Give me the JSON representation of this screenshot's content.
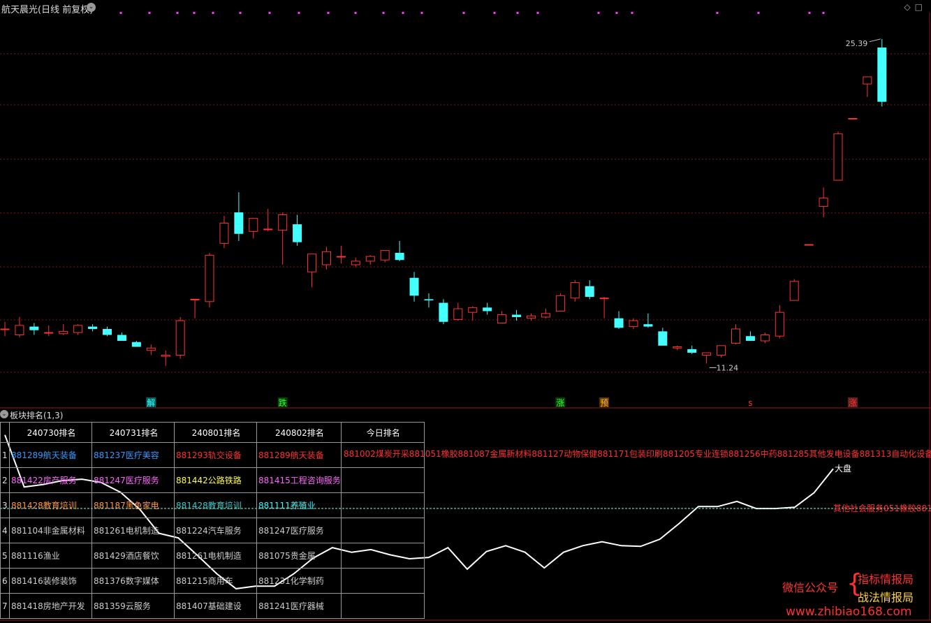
{
  "header": {
    "title": "航天晨光(日线 前复权)",
    "high_label": "25.39",
    "low_label": "11.24"
  },
  "sub_panel": {
    "title": "板块排名(1,3)",
    "index_label": "大盘"
  },
  "table": {
    "headers": [
      "",
      "240730排名",
      "240731排名",
      "240801排名",
      "240802排名",
      "今日排名"
    ],
    "rows": [
      {
        "no": "1",
        "cells": [
          {
            "t": "881289航天装备",
            "c": "#3399ff"
          },
          {
            "t": "881237医疗美容",
            "c": "#3399ff"
          },
          {
            "t": "881293轨交设备",
            "c": "#ff3030"
          },
          {
            "t": "881289航天装备",
            "c": "#ff3030"
          },
          {
            "t": "",
            "c": "#ff3030"
          }
        ]
      },
      {
        "no": "2",
        "cells": [
          {
            "t": "881422房产服务",
            "c": "#ff66ff"
          },
          {
            "t": "881247医疗服务",
            "c": "#ff66ff"
          },
          {
            "t": "881442公路铁路",
            "c": "#ffff44"
          },
          {
            "t": "881415工程咨询服务",
            "c": "#ff66ff"
          },
          {
            "t": "",
            "c": "#ff66ff"
          }
        ]
      },
      {
        "no": "3",
        "cells": [
          {
            "t": "881428教育培训",
            "c": "#ff9933"
          },
          {
            "t": "881187黑色家电",
            "c": "#ff9933"
          },
          {
            "t": "881428教育培训",
            "c": "#33cccc"
          },
          {
            "t": "881111养殖业",
            "c": "#33ffff"
          },
          {
            "t": "",
            "c": "#ff9933"
          }
        ]
      },
      {
        "no": "4",
        "cells": [
          {
            "t": "881104非金属材料",
            "c": "#ccc"
          },
          {
            "t": "881261电机制造",
            "c": "#ccc"
          },
          {
            "t": "881224汽车服务",
            "c": "#ccc"
          },
          {
            "t": "881247医疗服务",
            "c": "#ccc"
          },
          {
            "t": "",
            "c": "#ccc"
          }
        ]
      },
      {
        "no": "5",
        "cells": [
          {
            "t": "881116渔业",
            "c": "#ccc"
          },
          {
            "t": "881429酒店餐饮",
            "c": "#ccc"
          },
          {
            "t": "881261电机制造",
            "c": "#ccc"
          },
          {
            "t": "881075贵金属",
            "c": "#ccc"
          },
          {
            "t": "",
            "c": "#ccc"
          }
        ]
      },
      {
        "no": "6",
        "cells": [
          {
            "t": "881416装修装饰",
            "c": "#ccc"
          },
          {
            "t": "881376数字媒体",
            "c": "#ccc"
          },
          {
            "t": "881215商用车",
            "c": "#ccc"
          },
          {
            "t": "881231化学制药",
            "c": "#ccc"
          },
          {
            "t": "",
            "c": "#ccc"
          }
        ]
      },
      {
        "no": "7",
        "cells": [
          {
            "t": "881418房地产开发",
            "c": "#ccc"
          },
          {
            "t": "881359云服务",
            "c": "#ccc"
          },
          {
            "t": "881407基础建设",
            "c": "#ccc"
          },
          {
            "t": "881241医疗器械",
            "c": "#ccc"
          },
          {
            "t": "",
            "c": "#ccc"
          }
        ]
      }
    ],
    "today_rank_1": "881002煤炭开采881051橡胶881087金属新材料881127动物保健881171包装印刷881205专业连锁881256中药881285其他发电设备881313自动化设备881317"
  },
  "overlay_text": "其他社会服务051橡胶881",
  "watermark": {
    "line1": "微信公众号",
    "line2": "指标情报局",
    "line3": "战法情报局",
    "url": "www.zhibiao168.com"
  },
  "chart_data": [
    {
      "type": "candlestick",
      "title": "航天晨光(日线 前复权)",
      "y_axis_hidden": true,
      "ylim": [
        10.0,
        26.5
      ],
      "candles": [
        {
          "o": 13.2,
          "h": 13.5,
          "l": 12.9,
          "c": 13.2
        },
        {
          "o": 12.95,
          "h": 13.7,
          "l": 12.85,
          "c": 13.35
        },
        {
          "o": 13.3,
          "h": 13.45,
          "l": 12.95,
          "c": 13.15
        },
        {
          "o": 13.05,
          "h": 13.35,
          "l": 12.9,
          "c": 13.05
        },
        {
          "o": 13.0,
          "h": 13.4,
          "l": 12.95,
          "c": 13.1
        },
        {
          "o": 13.05,
          "h": 13.4,
          "l": 12.95,
          "c": 13.35
        },
        {
          "o": 13.3,
          "h": 13.4,
          "l": 13.1,
          "c": 13.2
        },
        {
          "o": 13.2,
          "h": 13.3,
          "l": 12.9,
          "c": 12.95
        },
        {
          "o": 12.95,
          "h": 13.05,
          "l": 12.7,
          "c": 12.7
        },
        {
          "o": 12.65,
          "h": 12.7,
          "l": 12.5,
          "c": 12.45
        },
        {
          "o": 12.3,
          "h": 12.55,
          "l": 12.1,
          "c": 12.4
        },
        {
          "o": 12.05,
          "h": 12.3,
          "l": 11.65,
          "c": 12.1
        },
        {
          "o": 12.1,
          "h": 13.7,
          "l": 11.95,
          "c": 13.55
        },
        {
          "o": 14.45,
          "h": 14.45,
          "l": 13.65,
          "c": 14.45
        },
        {
          "o": 14.35,
          "h": 16.4,
          "l": 14.1,
          "c": 16.3
        },
        {
          "o": 16.8,
          "h": 17.95,
          "l": 16.6,
          "c": 17.65
        },
        {
          "o": 18.1,
          "h": 18.95,
          "l": 16.9,
          "c": 17.2
        },
        {
          "o": 17.3,
          "h": 17.8,
          "l": 17.0,
          "c": 17.85
        },
        {
          "o": 17.4,
          "h": 18.25,
          "l": 17.3,
          "c": 17.4
        },
        {
          "o": 17.35,
          "h": 18.1,
          "l": 15.9,
          "c": 18.0
        },
        {
          "o": 17.6,
          "h": 18.0,
          "l": 16.7,
          "c": 16.85
        },
        {
          "o": 15.6,
          "h": 16.35,
          "l": 14.95,
          "c": 16.35
        },
        {
          "o": 15.9,
          "h": 16.65,
          "l": 15.7,
          "c": 16.45
        },
        {
          "o": 16.25,
          "h": 16.7,
          "l": 15.95,
          "c": 16.25
        },
        {
          "o": 15.9,
          "h": 16.2,
          "l": 15.8,
          "c": 16.05
        },
        {
          "o": 16.05,
          "h": 16.3,
          "l": 15.9,
          "c": 16.25
        },
        {
          "o": 16.1,
          "h": 16.5,
          "l": 16.0,
          "c": 16.5
        },
        {
          "o": 16.4,
          "h": 16.9,
          "l": 16.05,
          "c": 16.1
        },
        {
          "o": 15.35,
          "h": 15.6,
          "l": 14.35,
          "c": 14.6
        },
        {
          "o": 14.45,
          "h": 14.7,
          "l": 14.1,
          "c": 14.4
        },
        {
          "o": 14.3,
          "h": 14.45,
          "l": 13.4,
          "c": 13.5
        },
        {
          "o": 13.6,
          "h": 14.3,
          "l": 13.55,
          "c": 14.05
        },
        {
          "o": 13.9,
          "h": 14.15,
          "l": 13.55,
          "c": 14.1
        },
        {
          "o": 14.1,
          "h": 14.3,
          "l": 13.8,
          "c": 13.95
        },
        {
          "o": 13.45,
          "h": 13.95,
          "l": 13.45,
          "c": 13.8
        },
        {
          "o": 13.8,
          "h": 14.0,
          "l": 13.55,
          "c": 13.7
        },
        {
          "o": 13.65,
          "h": 13.85,
          "l": 13.55,
          "c": 13.75
        },
        {
          "o": 13.7,
          "h": 14.05,
          "l": 13.65,
          "c": 13.85
        },
        {
          "o": 13.95,
          "h": 14.7,
          "l": 13.95,
          "c": 14.6
        },
        {
          "o": 14.5,
          "h": 15.25,
          "l": 14.35,
          "c": 15.15
        },
        {
          "o": 15.0,
          "h": 15.25,
          "l": 14.45,
          "c": 14.55
        },
        {
          "o": 14.5,
          "h": 14.55,
          "l": 13.65,
          "c": 14.5
        },
        {
          "o": 13.65,
          "h": 13.95,
          "l": 13.2,
          "c": 13.25
        },
        {
          "o": 13.3,
          "h": 13.65,
          "l": 13.2,
          "c": 13.55
        },
        {
          "o": 13.4,
          "h": 13.85,
          "l": 13.25,
          "c": 13.3
        },
        {
          "o": 13.1,
          "h": 13.25,
          "l": 12.5,
          "c": 12.5
        },
        {
          "o": 12.4,
          "h": 12.5,
          "l": 12.3,
          "c": 12.45
        },
        {
          "o": 12.35,
          "h": 12.5,
          "l": 12.15,
          "c": 12.2
        },
        {
          "o": 12.1,
          "h": 12.2,
          "l": 11.75,
          "c": 12.2
        },
        {
          "o": 12.1,
          "h": 12.5,
          "l": 12.0,
          "c": 12.5
        },
        {
          "o": 12.6,
          "h": 13.4,
          "l": 12.55,
          "c": 13.2
        },
        {
          "o": 12.9,
          "h": 13.1,
          "l": 12.7,
          "c": 12.7
        },
        {
          "o": 12.7,
          "h": 13.05,
          "l": 12.6,
          "c": 12.95
        },
        {
          "o": 12.9,
          "h": 14.2,
          "l": 12.8,
          "c": 13.9
        },
        {
          "o": 14.4,
          "h": 15.3,
          "l": 14.4,
          "c": 15.2
        },
        {
          "o": 16.75,
          "h": 16.75,
          "l": 16.75,
          "c": 16.75
        },
        {
          "o": 18.35,
          "h": 19.15,
          "l": 17.9,
          "c": 18.7
        },
        {
          "o": 19.45,
          "h": 21.5,
          "l": 19.45,
          "c": 21.4
        },
        {
          "o": 22.05,
          "h": 22.05,
          "l": 22.05,
          "c": 22.05
        },
        {
          "o": 23.5,
          "h": 23.55,
          "l": 22.95,
          "c": 23.8
        },
        {
          "o": 25.03,
          "h": 25.39,
          "l": 22.55,
          "c": 22.75
        }
      ],
      "signals": [
        {
          "index": 10,
          "label": "解",
          "color": "#33ffff",
          "bg": "#006060"
        },
        {
          "index": 19,
          "label": "跌",
          "color": "#33ff33",
          "bg": "#004000"
        },
        {
          "index": 38,
          "label": "涨",
          "color": "#33ff33",
          "bg": "#004000"
        },
        {
          "index": 41,
          "label": "预",
          "color": "#ffcc00",
          "bg": "#603000"
        },
        {
          "index": 51,
          "label": "s",
          "color": "#ff3030",
          "bg": ""
        },
        {
          "index": 58,
          "label": "涨",
          "color": "#ff3030",
          "bg": "#602020"
        }
      ],
      "high_annotation": "25.39",
      "low_annotation": "11.24"
    },
    {
      "type": "line",
      "title": "板块排名(1,3)",
      "series": [
        {
          "name": "大盘",
          "values": [
            20,
            100,
            96,
            90,
            88,
            93,
            108,
            134,
            171,
            178,
            205,
            233,
            256,
            252,
            252,
            233,
            209,
            193,
            200,
            196,
            204,
            210,
            208,
            193,
            226,
            199,
            190,
            200,
            224,
            200,
            190,
            184,
            190,
            191,
            180,
            156,
            130,
            130,
            122,
            133,
            133,
            131,
            109,
            72
          ]
        }
      ],
      "ylim": [
        0,
        300
      ]
    }
  ]
}
